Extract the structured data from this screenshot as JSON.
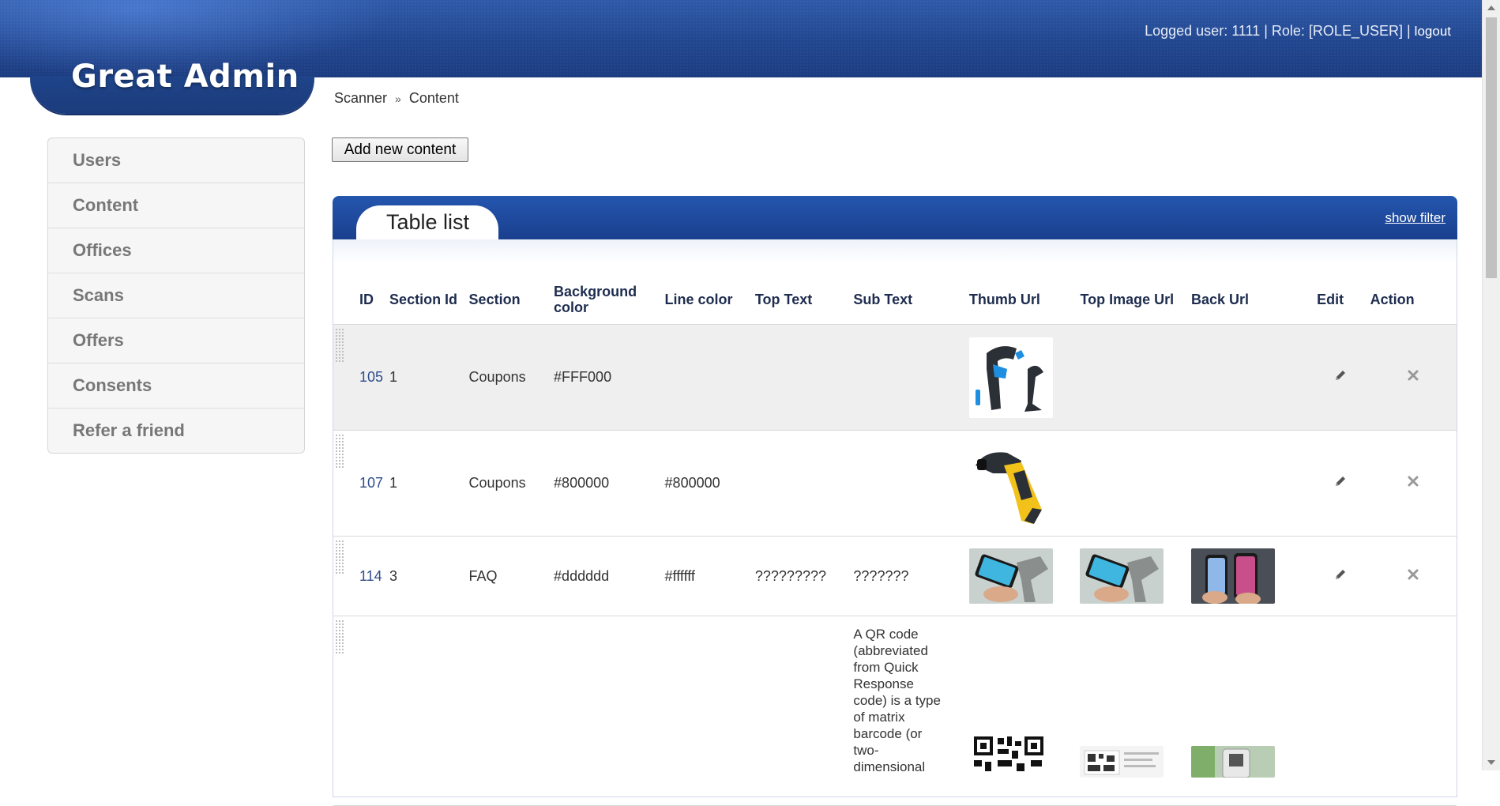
{
  "app": {
    "title": "Great Admin"
  },
  "user_bar": {
    "text": "Logged user: 1111 | Role: [ROLE_USER] |",
    "logout_label": "logout"
  },
  "breadcrumb": {
    "root": "Scanner",
    "separator": "»",
    "current": "Content"
  },
  "sidebar": {
    "items": [
      {
        "label": "Users"
      },
      {
        "label": "Content"
      },
      {
        "label": "Offices"
      },
      {
        "label": "Scans"
      },
      {
        "label": "Offers"
      },
      {
        "label": "Consents"
      },
      {
        "label": "Refer a friend"
      }
    ]
  },
  "toolbar": {
    "add_label": "Add new content"
  },
  "panel": {
    "title": "Table list",
    "filter_label": "show filter"
  },
  "table": {
    "columns": [
      "ID",
      "Section Id",
      "Section",
      "Background color",
      "Line color",
      "Top Text",
      "Sub Text",
      "Thumb Url",
      "Top Image Url",
      "Back Url",
      "Edit",
      "Action"
    ],
    "rows": [
      {
        "id": "105",
        "section_id": "1",
        "section": "Coupons",
        "bg_color": "#FFF000",
        "line_color": "",
        "top_text": "",
        "sub_text": "",
        "thumb": "scanner-blue-image",
        "top_image": "",
        "back": ""
      },
      {
        "id": "107",
        "section_id": "1",
        "section": "Coupons",
        "bg_color": "#800000",
        "line_color": "#800000",
        "top_text": "",
        "sub_text": "",
        "thumb": "scanner-yellow-image",
        "top_image": "",
        "back": ""
      },
      {
        "id": "114",
        "section_id": "3",
        "section": "FAQ",
        "bg_color": "#dddddd",
        "line_color": "#ffffff",
        "top_text": "?????????",
        "sub_text": "???????",
        "thumb": "phone-scan-image",
        "top_image": "phone-scan-image",
        "back": "phones-image"
      },
      {
        "id": "",
        "section_id": "",
        "section": "",
        "bg_color": "",
        "line_color": "",
        "top_text": "",
        "sub_text": "A QR code (abbreviated from Quick Response code) is a type of matrix barcode (or two-dimensional",
        "thumb": "qr-code-image",
        "top_image": "qr-document-image",
        "back": "phone-green-image"
      }
    ]
  },
  "colors": {
    "header_blue": "#21468f",
    "link_blue": "#2f4d8c",
    "row_highlight": "#efefef"
  }
}
